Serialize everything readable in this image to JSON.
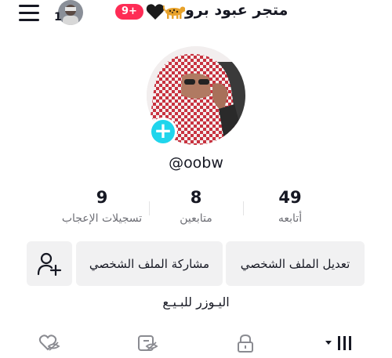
{
  "header": {
    "title": "متجر عبود برو",
    "avatar_count": "1",
    "notification_badge": "9+",
    "menu_icon": "hamburger-menu-icon",
    "heart_emoji_icon": "black-heart-icon",
    "leopard_emoji_icon": "leopard-icon"
  },
  "profile": {
    "username": "@oobw",
    "bio": "اليـوزر للبـيـع"
  },
  "stats": [
    {
      "value": "49",
      "label": "أتابعه"
    },
    {
      "value": "8",
      "label": "متابعين"
    },
    {
      "value": "9",
      "label": "تسجيلات الإعجاب"
    }
  ],
  "actions": {
    "edit_profile": "تعديل الملف الشخصي",
    "share_profile": "مشاركة الملف الشخصي",
    "add_friend_icon": "add-user-icon"
  },
  "tabs": [
    {
      "icon": "videos-grid-icon"
    },
    {
      "icon": "lock-icon"
    },
    {
      "icon": "reposts-hidden-icon"
    },
    {
      "icon": "liked-hidden-icon"
    }
  ],
  "colors": {
    "accent": "#fe2c55",
    "add_badge": "#20d5ec",
    "button_bg": "#f1f1f2",
    "muted_text": "#6e6f76"
  }
}
